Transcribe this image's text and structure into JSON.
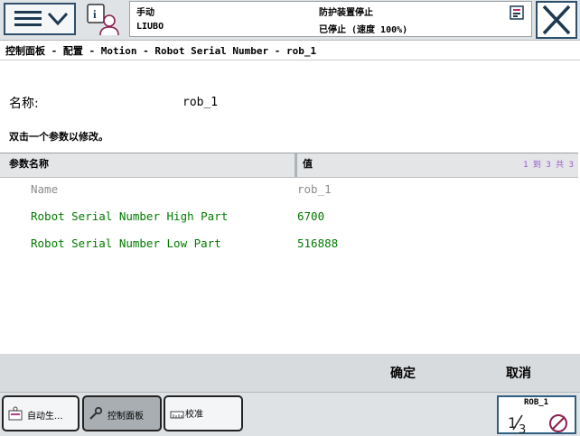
{
  "header": {
    "mode": "手动",
    "controller": "LIUBO",
    "protection_status": "防护装置停止",
    "run_status": "已停止 (速度 100%)"
  },
  "breadcrumb": "控制面板 - 配置 - Motion - Robot Serial Number - rob_1",
  "name_label": "名称:",
  "name_value": "rob_1",
  "instruction": "双击一个参数以修改。",
  "table": {
    "col_param": "参数名称",
    "col_value": "值",
    "count": "1 到 3 共 3",
    "rows": [
      {
        "name": "Name",
        "value": "rob_1",
        "color": "#8c8c8c"
      },
      {
        "name": "Robot Serial Number High Part",
        "value": "6700",
        "color": "#007a00"
      },
      {
        "name": "Robot Serial Number Low Part",
        "value": "516888",
        "color": "#007a00"
      }
    ]
  },
  "buttons": {
    "ok": "确定",
    "cancel": "取消"
  },
  "taskbar": {
    "items": [
      {
        "label": "自动生...",
        "icon": "auto-production-icon"
      },
      {
        "label": "控制面板",
        "icon": "wrench-icon"
      },
      {
        "label": "校准",
        "icon": "calibration-icon"
      }
    ],
    "robot": "ROB_1"
  },
  "icons": {
    "menu": "menu-icon",
    "info": "info-user-icon",
    "close": "close-icon",
    "status": "status-flag-icon"
  },
  "colors": {
    "accent": "#2e4f6b",
    "param_green": "#007a00",
    "param_gray": "#8c8c8c",
    "count_purple": "#9b59d0"
  }
}
